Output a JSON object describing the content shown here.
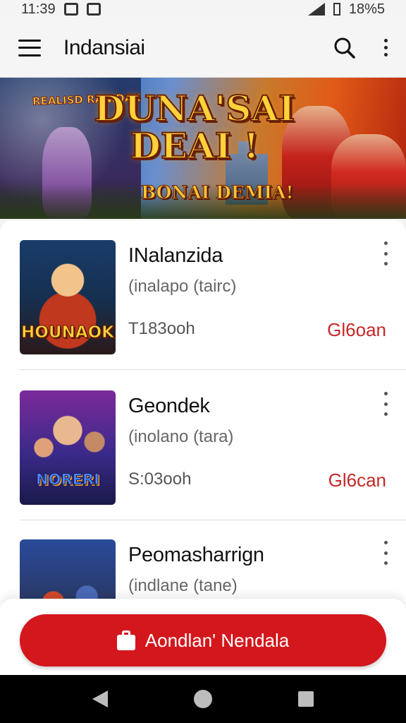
{
  "status_bar": {
    "time": "11:39",
    "right_text": "18%5"
  },
  "app_bar": {
    "menu_icon": "hamburger-menu-icon",
    "title": "Indansiai",
    "search_icon": "search-icon",
    "overflow_icon": "more-vert-icon"
  },
  "banner": {
    "small_text": "REALISD RANIDAX",
    "title_line1": "DUNA'SAI",
    "title_line2": "DEAI !",
    "subtitle": "BONAI DEMIA!"
  },
  "list": {
    "items": [
      {
        "title": "INalanzida",
        "subtitle": "(inalapo (tairc)",
        "meta": "T183ooh",
        "status": "Gl6oan",
        "thumb_text": "HOUNAOK"
      },
      {
        "title": "Geondek",
        "subtitle": "(inolano (tara)",
        "meta": "S:03ooh",
        "status": "Gl6can",
        "thumb_text": "NORERI"
      },
      {
        "title": "Peomasharrign",
        "subtitle": "(indlane (tane)",
        "meta": "",
        "status": "",
        "thumb_text": ""
      }
    ]
  },
  "cta": {
    "label": "Aondlan' Nendala",
    "icon": "shopping-bag-icon"
  },
  "colors": {
    "accent_red": "#d3171c",
    "status_red": "#c62828",
    "app_bar_bg": "#f5f5f5"
  }
}
